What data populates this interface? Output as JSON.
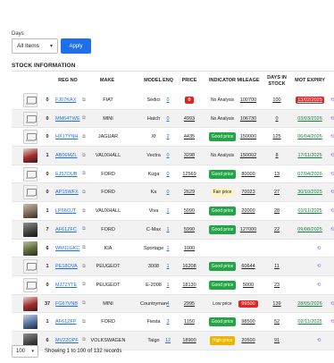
{
  "filter": {
    "label": "Days",
    "selected": "All Items",
    "apply_label": "Apply"
  },
  "section_title": "STOCK INFORMATION",
  "columns": [
    "REG NO",
    "MAKE",
    "MODEL",
    "ENQ",
    "PRICE",
    "INDICATOR",
    "MILEAGE",
    "DAYS IN STOCK",
    "MOT EXPIRY"
  ],
  "rows": [
    {
      "thumb": "ph",
      "count": "0",
      "reg": "FJ07KAX",
      "make": "FIAT",
      "model": "Sedici",
      "enq": "0",
      "price": "0",
      "price_style": "zero",
      "indicator": "No Analysis",
      "ind_style": "none",
      "mileage": "100700",
      "days": "100",
      "mot": "13/02/2025",
      "mot_style": "red"
    },
    {
      "thumb": "ph",
      "count": "0",
      "reg": "MM64TWE",
      "make": "MINI",
      "model": "Hatch",
      "enq": "0",
      "price": "4993",
      "price_style": "link",
      "indicator": "No Analysis",
      "ind_style": "none",
      "mileage": "106730",
      "days": "0",
      "mot": "03/03/2026",
      "mot_style": "green"
    },
    {
      "thumb": "ph",
      "count": "0",
      "reg": "HX17YNH",
      "make": "JAGUAR",
      "model": "Xf",
      "enq": "2",
      "price": "4435",
      "price_style": "link",
      "indicator": "Good price",
      "ind_style": "good",
      "mileage": "150000",
      "days": "125",
      "mot": "06/04/2026",
      "mot_style": "green"
    },
    {
      "thumb": "red",
      "count": "1",
      "reg": "AB06MZL",
      "make": "VAUXHALL",
      "model": "Vectra",
      "enq": "0",
      "price": "3298",
      "price_style": "link",
      "indicator": "No Analysis",
      "ind_style": "none",
      "mileage": "150002",
      "days": "8",
      "mot": "17/11/2025",
      "mot_style": "green"
    },
    {
      "thumb": "ph",
      "count": "0",
      "reg": "EJ57OUB",
      "make": "FORD",
      "model": "Kuga",
      "enq": "0",
      "price": "12569",
      "price_style": "link",
      "indicator": "Good price",
      "ind_style": "good",
      "mileage": "80000",
      "days": "13",
      "mot": "07/04/2026",
      "mot_style": "green"
    },
    {
      "thumb": "ph",
      "count": "0",
      "reg": "AP15WFX",
      "make": "FORD",
      "model": "Ka",
      "enq": "0",
      "price": "2629",
      "price_style": "link",
      "indicator": "Fair price",
      "ind_style": "fair",
      "mileage": "70023",
      "days": "27",
      "mot": "30/10/2025",
      "mot_style": "green"
    },
    {
      "thumb": "photo",
      "count": "1",
      "reg": "LP66OJT",
      "make": "VAUXHALL",
      "model": "Viva",
      "enq": "1",
      "price": "5090",
      "price_style": "link",
      "indicator": "Good price",
      "ind_style": "good",
      "mileage": "20000",
      "days": "28",
      "mot": "01/11/2025",
      "mot_style": "green"
    },
    {
      "thumb": "dark",
      "count": "7",
      "reg": "AF61ZFC",
      "make": "FORD",
      "model": "C-Max",
      "enq": "1",
      "price": "5990",
      "price_style": "link",
      "indicator": "Good price",
      "ind_style": "good",
      "mileage": "127000",
      "days": "22",
      "mot": "09/08/2025",
      "mot_style": "green"
    },
    {
      "thumb": "green",
      "count": "6",
      "reg": "WM11GKC",
      "make": "KIA",
      "model": "Sportage",
      "enq": "1",
      "price": "1000",
      "price_style": "link",
      "indicator": "",
      "ind_style": "",
      "mileage": "",
      "days": "",
      "mot": "",
      "mot_style": ""
    },
    {
      "thumb": "ph",
      "count": "1",
      "reg": "PE18OVA",
      "make": "PEUGEOT",
      "model": "3008",
      "enq": "1",
      "price": "16208",
      "price_style": "link",
      "indicator": "Good price",
      "ind_style": "good",
      "mileage": "60644",
      "days": "11",
      "mot": "",
      "mot_style": ""
    },
    {
      "thumb": "ph",
      "count": "0",
      "reg": "MJ72YTE",
      "make": "PEUGEOT",
      "model": "E-2008",
      "enq": "1",
      "price": "18130",
      "price_style": "link",
      "indicator": "Good price",
      "ind_style": "good",
      "mileage": "5000",
      "days": "23",
      "mot": "",
      "mot_style": ""
    },
    {
      "thumb": "red",
      "count": "37",
      "reg": "FG67VNB",
      "make": "MINI",
      "model": "Countryman",
      "enq": "4",
      "price": "2995",
      "price_style": "link",
      "indicator": "Low price",
      "ind_style": "low",
      "mileage": "99500",
      "mile_style": "red",
      "days": "139",
      "mot": "28/05/2026",
      "mot_style": "green"
    },
    {
      "thumb": "blue",
      "count": "1",
      "reg": "AF61ZFP",
      "make": "FORD",
      "model": "Fiesta",
      "enq": "3",
      "price": "1150",
      "price_style": "link",
      "indicator": "Good price",
      "ind_style": "good",
      "mileage": "98500",
      "days": "52",
      "mot": "02/11/2025",
      "mot_style": "green"
    },
    {
      "thumb": "dark",
      "count": "6",
      "reg": "MV22OPF",
      "make": "VOLKSWAGEN",
      "model": "Taigo",
      "enq": "12",
      "price": "18900",
      "price_style": "link",
      "indicator": "High price",
      "ind_style": "high",
      "mileage": "20500",
      "days": "91",
      "mot": "",
      "mot_style": ""
    }
  ],
  "footer": {
    "per_page": "100",
    "showing": "Showing 1 to 100 of 132 records"
  },
  "colors": {
    "accent": "#1f6feb",
    "good": "#22a447",
    "alert": "#e02424",
    "high": "#f0b400",
    "sync": "#8b5cf6"
  }
}
